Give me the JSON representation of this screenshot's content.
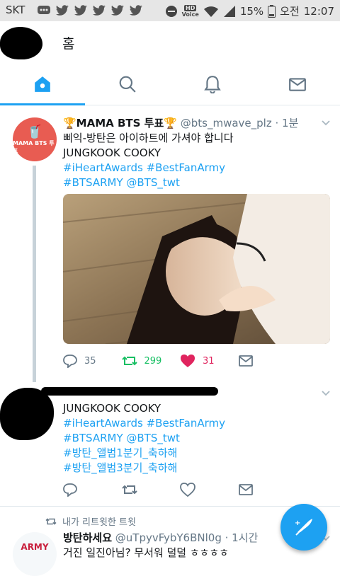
{
  "status_bar": {
    "carrier": "SKT",
    "battery": "15%",
    "ampm": "오전",
    "time": "12:07",
    "hd_label": "HD",
    "voice_label": "Voice"
  },
  "header": {
    "title": "홈"
  },
  "tabs": [
    {
      "name": "home",
      "icon": "home-icon",
      "active": true
    },
    {
      "name": "search",
      "icon": "search-icon",
      "active": false
    },
    {
      "name": "notifications",
      "icon": "bell-icon",
      "active": false
    },
    {
      "name": "messages",
      "icon": "mail-icon",
      "active": false
    }
  ],
  "tweet1": {
    "avatar_text": "MAMA BTS 투표",
    "display_name": "🏆MAMA BTS 투표🏆",
    "handle": "@bts_mwave_plz",
    "time": "· 1분",
    "line1": "삐익-방탄은 아이하트에 가셔야 합니다",
    "line2": "JUNGKOOK COOKY",
    "line3": "#iHeartAwards #BestFanArmy",
    "line4": "#BTSARMY @BTS_twt",
    "replies": "35",
    "retweets": "299",
    "likes": "31"
  },
  "tweet2": {
    "line1": "JUNGKOOK COOKY",
    "line2": "#iHeartAwards #BestFanArmy",
    "line3": "#BTSARMY @BTS_twt",
    "line4": "#방탄_앨범1분기_축하해",
    "line5": "#방탄_앨범3분기_축하해"
  },
  "tweet3": {
    "retweet_note": "내가 리트윗한 트윗",
    "avatar_text": "ARMY",
    "display_name": "방탄하세요",
    "handle": "@uTpyvFybY6BNl0g",
    "time": "· 1시간",
    "text": "거진 일진아님? 무서워 덜덜 ㅎㅎㅎㅎ"
  },
  "colors": {
    "accent": "#1da1f2",
    "retweet": "#17bf63",
    "like": "#e0245e",
    "muted": "#657786"
  }
}
